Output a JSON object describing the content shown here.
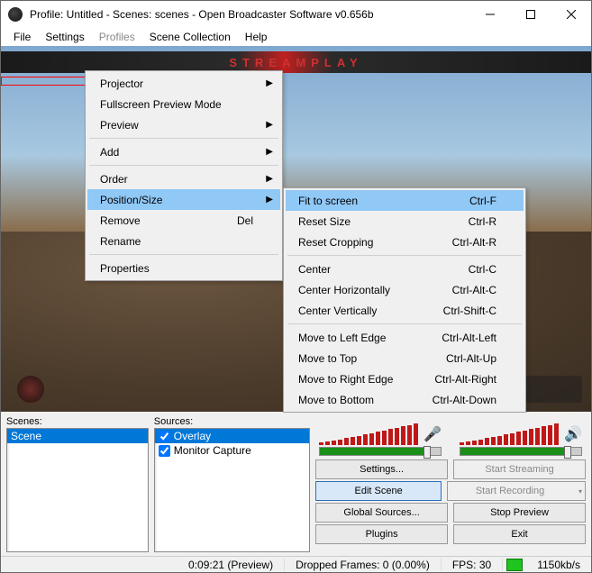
{
  "window": {
    "title": "Profile: Untitled - Scenes: scenes - Open Broadcaster Software v0.656b"
  },
  "menubar": {
    "items": [
      {
        "label": "File",
        "enabled": true
      },
      {
        "label": "Settings",
        "enabled": true
      },
      {
        "label": "Profiles",
        "enabled": false
      },
      {
        "label": "Scene Collection",
        "enabled": true
      },
      {
        "label": "Help",
        "enabled": true
      }
    ]
  },
  "overlay_banner": "STREAMPLAY",
  "context_menu_1": {
    "items": [
      {
        "label": "Projector",
        "submenu": true
      },
      {
        "label": "Fullscreen Preview Mode"
      },
      {
        "label": "Preview",
        "submenu": true
      },
      {
        "sep": true
      },
      {
        "label": "Add",
        "submenu": true
      },
      {
        "sep": true
      },
      {
        "label": "Order",
        "submenu": true
      },
      {
        "label": "Position/Size",
        "submenu": true,
        "highlight": true
      },
      {
        "label": "Remove",
        "shortcut": "Del"
      },
      {
        "label": "Rename"
      },
      {
        "sep": true
      },
      {
        "label": "Properties"
      }
    ]
  },
  "context_menu_2": {
    "items": [
      {
        "label": "Fit to screen",
        "shortcut": "Ctrl-F",
        "highlight": true
      },
      {
        "label": "Reset Size",
        "shortcut": "Ctrl-R"
      },
      {
        "label": "Reset Cropping",
        "shortcut": "Ctrl-Alt-R"
      },
      {
        "sep": true
      },
      {
        "label": "Center",
        "shortcut": "Ctrl-C"
      },
      {
        "label": "Center Horizontally",
        "shortcut": "Ctrl-Alt-C"
      },
      {
        "label": "Center Vertically",
        "shortcut": "Ctrl-Shift-C"
      },
      {
        "sep": true
      },
      {
        "label": "Move to Left Edge",
        "shortcut": "Ctrl-Alt-Left"
      },
      {
        "label": "Move to Top",
        "shortcut": "Ctrl-Alt-Up"
      },
      {
        "label": "Move to Right Edge",
        "shortcut": "Ctrl-Alt-Right"
      },
      {
        "label": "Move to Bottom",
        "shortcut": "Ctrl-Alt-Down"
      }
    ]
  },
  "scenes": {
    "label": "Scenes:",
    "items": [
      "Scene"
    ]
  },
  "sources": {
    "label": "Sources:",
    "items": [
      {
        "label": "Overlay",
        "checked": true,
        "selected": true
      },
      {
        "label": "Monitor Capture",
        "checked": true,
        "selected": false
      }
    ]
  },
  "buttons": {
    "settings": "Settings...",
    "start_streaming": "Start Streaming",
    "edit_scene": "Edit Scene",
    "start_recording": "Start Recording",
    "global_sources": "Global Sources...",
    "stop_preview": "Stop Preview",
    "plugins": "Plugins",
    "exit": "Exit"
  },
  "status": {
    "time": "0:09:21 (Preview)",
    "dropped": "Dropped Frames: 0 (0.00%)",
    "fps": "FPS: 30",
    "bitrate": "1150kb/s"
  }
}
